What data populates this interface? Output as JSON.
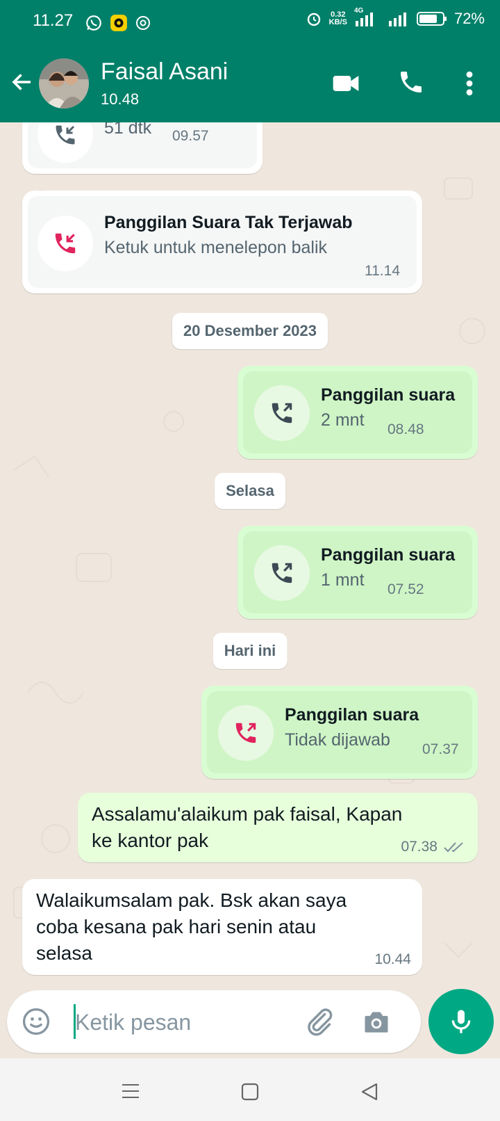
{
  "status_bar": {
    "time": "11.27",
    "net_speed_value": "0.32",
    "net_speed_unit": "KB/S",
    "net_type": "4G",
    "battery": "72%"
  },
  "header": {
    "contact_name": "Faisal Asani",
    "subtitle": "10.48"
  },
  "messages": [
    {
      "kind": "call",
      "dir": "in",
      "title": "",
      "subtitle": "51 dtk",
      "time": "09.57",
      "icon": "incoming-call-icon"
    },
    {
      "kind": "call",
      "dir": "in",
      "title": "Panggilan Suara Tak Terjawab",
      "subtitle": "Ketuk untuk menelepon balik",
      "time": "11.14",
      "icon": "missed-call-icon"
    },
    {
      "kind": "date",
      "label": "20 Desember 2023"
    },
    {
      "kind": "call",
      "dir": "out",
      "title": "Panggilan suara",
      "subtitle": "2 mnt",
      "time": "08.48",
      "icon": "outgoing-call-icon"
    },
    {
      "kind": "date",
      "label": "Selasa"
    },
    {
      "kind": "call",
      "dir": "out",
      "title": "Panggilan suara",
      "subtitle": "1 mnt",
      "time": "07.52",
      "icon": "outgoing-call-icon"
    },
    {
      "kind": "date",
      "label": "Hari ini"
    },
    {
      "kind": "call",
      "dir": "out",
      "title": "Panggilan suara",
      "subtitle": "Tidak dijawab",
      "time": "07.37",
      "icon": "outgoing-call-unanswered-icon"
    },
    {
      "kind": "text",
      "dir": "out",
      "lines": [
        "Assalamu'alaikum  pak faisal, Kapan",
        "ke kantor pak"
      ],
      "time": "07.38",
      "status": "read-ticks"
    },
    {
      "kind": "text",
      "dir": "in",
      "lines": [
        "Walaikumsalam pak. Bsk akan saya",
        "coba kesana pak hari senin atau",
        "selasa"
      ],
      "time": "10.44"
    }
  ],
  "composer": {
    "placeholder": "Ketik pesan"
  },
  "colors": {
    "header": "#008069",
    "accent": "#00a884",
    "missed": "#e0245e",
    "outgoing_bubble": "#d9fdd3",
    "chat_bg": "#efe7de"
  }
}
